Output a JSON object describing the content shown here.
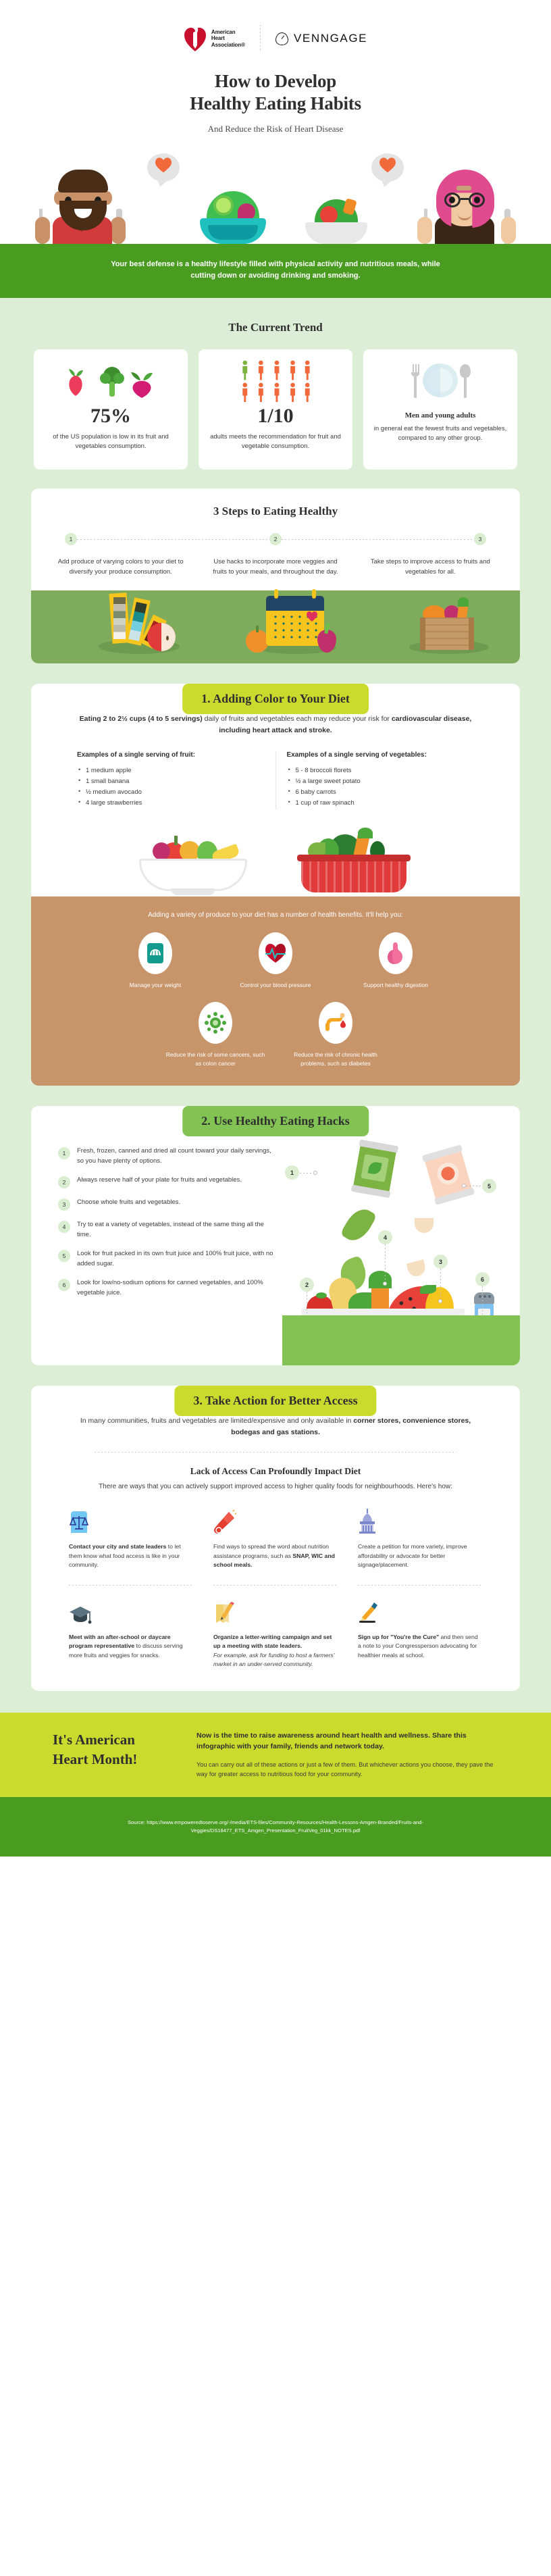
{
  "header": {
    "aha_logo_lines": [
      "American",
      "Heart",
      "Association®"
    ],
    "venngage_label": "VENNGAGE",
    "title_line1": "How to Develop",
    "title_line2": "Healthy Eating Habits",
    "subtitle": "And Reduce the Risk of Heart Disease"
  },
  "banner": {
    "text": "Your best defense is a healthy lifestyle filled with physical activity and nutritious meals, while cutting down or avoiding drinking and smoking."
  },
  "trend": {
    "title": "The Current Trend",
    "cards": [
      {
        "icon": "fruit-vegetable-icon",
        "stat": "75%",
        "caption": "of the US population is low in its fruit and vegetables consumption."
      },
      {
        "icon": "people-ratio-icon",
        "stat": "1/10",
        "caption": "adults meets the recommendation for fruit and vegetable consumption."
      },
      {
        "icon": "empty-plate-icon",
        "heading": "Men and young adults",
        "caption": "in general eat the fewest fruits and vegetables, compared to any other group."
      }
    ]
  },
  "steps": {
    "title": "3 Steps to Eating Healthy",
    "items": [
      {
        "num": "1",
        "text": "Add produce of varying colors to your diet to diversify your produce consumption.",
        "icon": "color-swatch-apple-icon"
      },
      {
        "num": "2",
        "text": "Use hacks to incorporate more veggies and fruits to your meals, and throughout the day.",
        "icon": "calendar-veggies-icon"
      },
      {
        "num": "3",
        "text": "Take steps to improve access to fruits and vegetables for all.",
        "icon": "produce-crate-icon"
      }
    ]
  },
  "section1": {
    "pill": "1. Adding Color to Your Diet",
    "lead_bold_1": "Eating 2 to 2½ cups (4 to 5 servings)",
    "lead_mid": " daily of fruits and vegetables each may reduce your risk for ",
    "lead_bold_2": "cardiovascular disease, including heart attack and stroke.",
    "fruit_heading": "Examples of a single serving of fruit:",
    "fruit_items": [
      "1 medium apple",
      "1 small banana",
      "½ medium avocado",
      "4 large strawberries"
    ],
    "veg_heading": "Examples of a single serving of vegetables:",
    "veg_items": [
      "5 - 8 broccoli florets",
      "½ a large sweet potato",
      "6 baby carrots",
      "1 cup of raw spinach"
    ],
    "benefits_lead": "Adding a variety of produce to your diet has a number of health benefits. It'll help you:",
    "benefits": [
      {
        "icon": "weight-scale-icon",
        "label": "Manage your weight"
      },
      {
        "icon": "heart-pulse-icon",
        "label": "Control your blood pressure"
      },
      {
        "icon": "stomach-icon",
        "label": "Support healthy digestion"
      },
      {
        "icon": "virus-cell-icon",
        "label": "Reduce the risk of some cancers, such as colon cancer"
      },
      {
        "icon": "blood-drop-finger-icon",
        "label": "Reduce the risk of chronic health problems, such as diabetes"
      }
    ]
  },
  "section2": {
    "pill": "2. Use Healthy Eating Hacks",
    "hacks": [
      {
        "num": "1",
        "text": "Fresh, frozen, canned and dried all count toward your daily servings, so you have plenty of options."
      },
      {
        "num": "2",
        "text": "Always reserve half of your plate for fruits and vegetables."
      },
      {
        "num": "3",
        "text": "Choose whole fruits and vegetables."
      },
      {
        "num": "4",
        "text": "Try to eat a variety of vegetables, instead of the same thing all the time."
      },
      {
        "num": "5",
        "text": "Look for fruit packed in its own fruit juice and 100% fruit juice, with no added sugar."
      },
      {
        "num": "6",
        "text": "Look for low/no-sodium options for canned vegetables, and 100% vegetable juice."
      }
    ],
    "callout_numbers": [
      "1",
      "5",
      "4",
      "2",
      "3",
      "6"
    ]
  },
  "section3": {
    "pill": "3. Take Action for Better Access",
    "lead_plain_1": "In many communities, fruits and vegetables are limited/expensive and only available in ",
    "lead_bold_1": "corner stores, convenience stores, bodegas and gas stations.",
    "sub_head": "Lack of Access Can Profoundly Impact Diet",
    "sub_lead": "There are ways that you can actively support improved access to higher quality foods for neighbourhoods. Here's how:",
    "actions_row1": [
      {
        "icon": "scales-justice-icon",
        "bold": "Contact your city and state leaders",
        "rest": " to let them know what food access is like in your community."
      },
      {
        "icon": "megaphone-icon",
        "plain_before": "Find ways to spread the word about nutrition assistance programs, such as ",
        "bold": "SNAP, WIC and school meals."
      },
      {
        "icon": "capitol-building-icon",
        "plain_only": "Create a petition for more variety, improve affordability or advocate for better signage/placement."
      }
    ],
    "actions_row2": [
      {
        "icon": "graduation-cap-icon",
        "bold": "Meet with an after-school or daycare program representative",
        "rest": " to discuss serving more fruits and veggies for snacks."
      },
      {
        "icon": "notebook-pencil-icon",
        "bold": "Organize a letter-writing campaign and set up a meeting with state leaders.",
        "italic": "For example, ask for funding to host a farmers' market in an under-served community."
      },
      {
        "icon": "fountain-pen-icon",
        "bold": "Sign up for \"You're the Cure\"",
        "rest": " and then send a note to your Congressperson advocating for healthier meals at school."
      }
    ]
  },
  "cta": {
    "title_line1": "It's American",
    "title_line2": "Heart Month!",
    "strong": "Now is the time to raise awareness around heart health and wellness. Share this infographic with your family, friends and network today.",
    "small": "You can carry out all of these actions or just a few of them. But whichever actions you choose, they pave the way for greater access to nutritious food for your community."
  },
  "source": {
    "text": "Source: https://www.empoweredtoserve.org/-/media/ETS-files/Community-Resources/Health-Lessons-Amgen-Branded/Fruits-and-Veggies/DS18477_ETS_Amgen_Presentation_FruitVeg_01kk_NOTES.pdf"
  },
  "colors": {
    "brand_red": "#C8102E",
    "dark_green": "#4A9C21",
    "mid_green": "#82C354",
    "lime": "#CBDB2E",
    "light_green_bg": "#DDEED6",
    "tan": "#C8946A"
  }
}
